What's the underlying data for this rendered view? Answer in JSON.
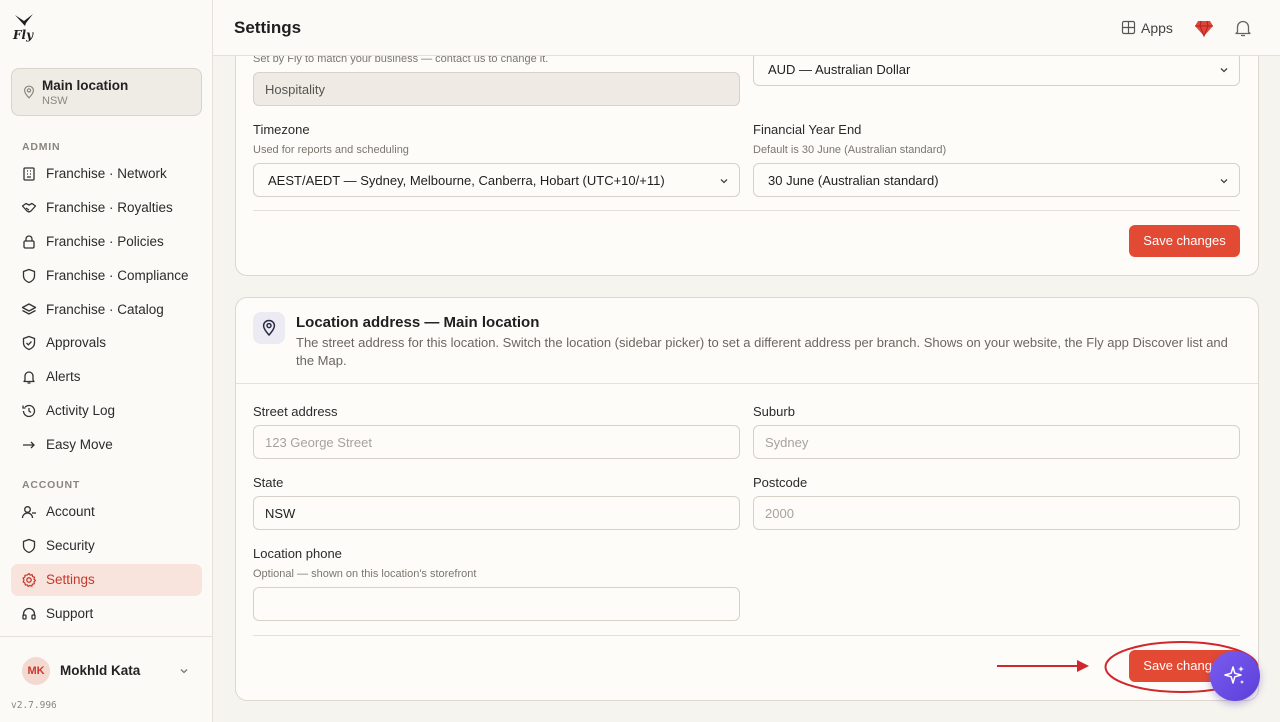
{
  "app": {
    "logo_text": "Fly",
    "version": "v2.7.996"
  },
  "location_picker": {
    "name": "Main location",
    "state": "NSW"
  },
  "sidebar": {
    "admin_label": "ADMIN",
    "admin_items": [
      {
        "label": "Franchise · Network",
        "icon": "building-icon"
      },
      {
        "label": "Franchise · Royalties",
        "icon": "handshake-icon"
      },
      {
        "label": "Franchise · Policies",
        "icon": "lock-icon"
      },
      {
        "label": "Franchise · Compliance",
        "icon": "shield-icon"
      },
      {
        "label": "Franchise · Catalog",
        "icon": "layers-icon"
      },
      {
        "label": "Approvals",
        "icon": "shield-check-icon"
      },
      {
        "label": "Alerts",
        "icon": "bell-icon"
      },
      {
        "label": "Activity Log",
        "icon": "history-icon"
      },
      {
        "label": "Easy Move",
        "icon": "arrow-right-icon"
      }
    ],
    "account_label": "ACCOUNT",
    "account_items": [
      {
        "label": "Account",
        "icon": "user-icon"
      },
      {
        "label": "Security",
        "icon": "shield-icon"
      },
      {
        "label": "Settings",
        "icon": "gear-icon",
        "active": true
      },
      {
        "label": "Support",
        "icon": "headset-icon"
      }
    ]
  },
  "user": {
    "initials": "MK",
    "name": "Mokhld Kata"
  },
  "topbar": {
    "title": "Settings",
    "apps_label": "Apps"
  },
  "business_card": {
    "industry_help": "Set by Fly to match your business — contact us to change it.",
    "industry_value": "Hospitality",
    "currency_value": "AUD — Australian Dollar",
    "timezone_label": "Timezone",
    "timezone_help": "Used for reports and scheduling",
    "timezone_value": "AEST/AEDT — Sydney, Melbourne, Canberra, Hobart (UTC+10/+11)",
    "fye_label": "Financial Year End",
    "fye_help": "Default is 30 June (Australian standard)",
    "fye_value": "30 June (Australian standard)",
    "save_label": "Save changes"
  },
  "address_card": {
    "title": "Location address — Main location",
    "description": "The street address for this location. Switch the location (sidebar picker) to set a different address per branch. Shows on your website, the Fly app Discover list and the Map.",
    "street_label": "Street address",
    "street_placeholder": "123 George Street",
    "suburb_label": "Suburb",
    "suburb_placeholder": "Sydney",
    "state_label": "State",
    "state_value": "NSW",
    "postcode_label": "Postcode",
    "postcode_placeholder": "2000",
    "phone_label": "Location phone",
    "phone_help": "Optional — shown on this location's storefront",
    "phone_value": "",
    "save_label": "Save changes"
  },
  "colors": {
    "accent": "#e24a33",
    "active_bg": "#f8e4dc",
    "annotation": "#d0262c",
    "ai_fab": "#6a4ce6"
  }
}
